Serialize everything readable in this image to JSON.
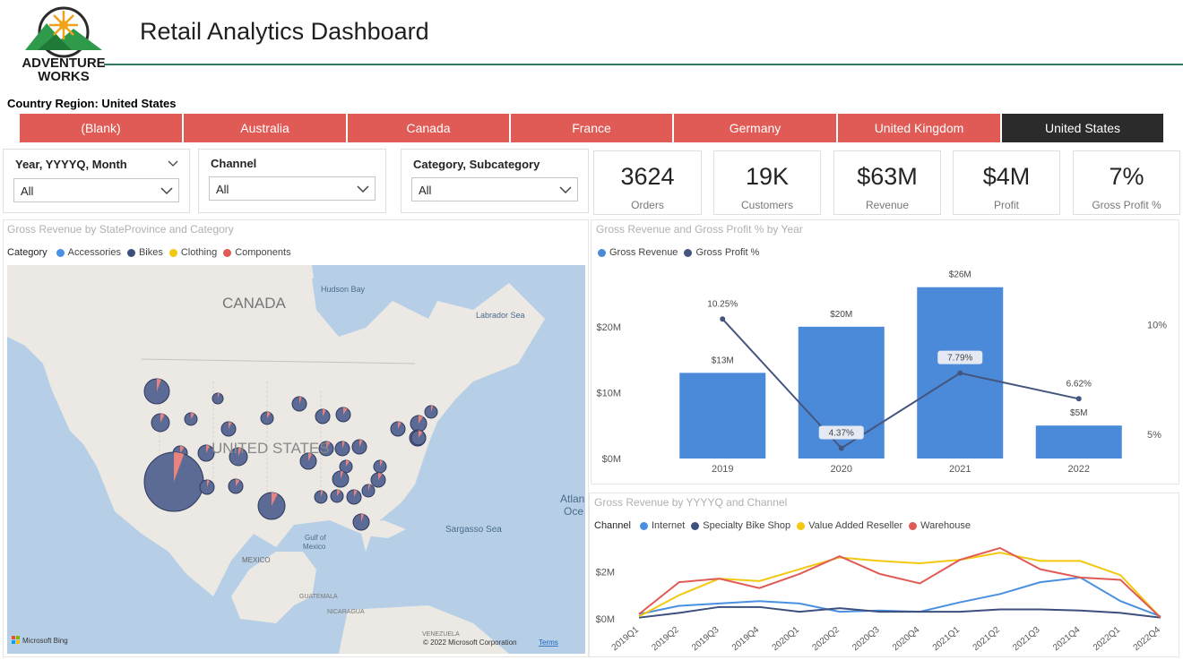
{
  "header": {
    "logo_text_line1": "ADVENTURE",
    "logo_text_line2": "WORKS",
    "title": "Retail Analytics Dashboard",
    "country_label": "Country Region: United States"
  },
  "country_tabs": [
    {
      "label": "(Blank)",
      "selected": false
    },
    {
      "label": "Australia",
      "selected": false
    },
    {
      "label": "Canada",
      "selected": false
    },
    {
      "label": "France",
      "selected": false
    },
    {
      "label": "Germany",
      "selected": false
    },
    {
      "label": "United Kingdom",
      "selected": false
    },
    {
      "label": "United States",
      "selected": true
    }
  ],
  "slicers": [
    {
      "header": "Year, YYYYQ, Month",
      "value": "All"
    },
    {
      "header": "Channel",
      "value": "All"
    },
    {
      "header": "Category, Subcategory",
      "value": "All"
    }
  ],
  "cards": [
    {
      "value": "3624",
      "label": "Orders"
    },
    {
      "value": "19K",
      "label": "Customers"
    },
    {
      "value": "$63M",
      "label": "Revenue"
    },
    {
      "value": "$4M",
      "label": "Profit"
    },
    {
      "value": "7%",
      "label": "Gross Profit %"
    }
  ],
  "map_visual": {
    "title": "Gross Revenue by StateProvince and Category",
    "legend_title": "Category",
    "legend": [
      {
        "name": "Accessories",
        "color": "#4a90e2"
      },
      {
        "name": "Bikes",
        "color": "#3d4f7c"
      },
      {
        "name": "Clothing",
        "color": "#f2c811"
      },
      {
        "name": "Components",
        "color": "#e05b55"
      }
    ],
    "labels": {
      "canada": "CANADA",
      "hudson": "Hudson Bay",
      "labrador": "Labrador Sea",
      "us": "UNITED STATES",
      "atlantic": "Atlan\nOce",
      "sargasso": "Sargasso Sea",
      "gulf": "Gulf of\nMexico",
      "mexico": "MEXICO",
      "guatemala": "GUATEMALA",
      "nicaragua": "NICARAGUA",
      "venezuela": "VENEZUELA",
      "bing": "Microsoft Bing",
      "copyright": "© 2022 Microsoft Corporation",
      "terms": "Terms"
    }
  },
  "chart_data": [
    {
      "type": "bar",
      "title": "Gross Revenue and Gross Profit % by Year",
      "categories": [
        "2019",
        "2020",
        "2021",
        "2022"
      ],
      "series": [
        {
          "name": "Gross Revenue",
          "type": "bar",
          "values": [
            13,
            20,
            26,
            5
          ],
          "unit": "$M",
          "data_labels": [
            "$13M",
            "$20M",
            "$26M",
            "$5M"
          ],
          "color": "#4a8ad9"
        },
        {
          "name": "Gross Profit %",
          "type": "line",
          "values": [
            10.25,
            4.37,
            7.79,
            6.62
          ],
          "data_labels": [
            "10.25%",
            "4.37%",
            "7.79%",
            "6.62%"
          ],
          "color": "#45567e"
        }
      ],
      "y_ticks": [
        "$0M",
        "$10M",
        "$20M"
      ],
      "ylim": [
        0,
        28
      ],
      "y2_ticks": [
        "5%",
        "10%"
      ],
      "y2lim": [
        3.9,
        12.3
      ]
    },
    {
      "type": "line",
      "title": "Gross Revenue by YYYYQ and Channel",
      "legend_title": "Channel",
      "categories": [
        "2019Q1",
        "2019Q2",
        "2019Q3",
        "2019Q4",
        "2020Q1",
        "2020Q2",
        "2020Q3",
        "2020Q4",
        "2021Q1",
        "2021Q2",
        "2021Q3",
        "2021Q4",
        "2022Q1",
        "2022Q4"
      ],
      "y_ticks": [
        "$0M",
        "$2M"
      ],
      "ylim": [
        0,
        3.3
      ],
      "series": [
        {
          "name": "Internet",
          "color": "#4a90e2",
          "values": [
            0.2,
            0.55,
            0.65,
            0.75,
            0.65,
            0.3,
            0.35,
            0.3,
            0.7,
            1.05,
            1.55,
            1.75,
            0.75,
            0.1
          ]
        },
        {
          "name": "Specialty Bike Shop",
          "color": "#3d4f7c",
          "values": [
            0.05,
            0.25,
            0.5,
            0.5,
            0.3,
            0.45,
            0.3,
            0.3,
            0.3,
            0.4,
            0.4,
            0.35,
            0.25,
            0.05
          ]
        },
        {
          "name": "Value Added Reseller",
          "color": "#f2c811",
          "values": [
            0.1,
            1.0,
            1.7,
            1.6,
            2.1,
            2.6,
            2.45,
            2.35,
            2.5,
            2.8,
            2.45,
            2.45,
            1.85,
            0.05
          ]
        },
        {
          "name": "Warehouse",
          "color": "#e05b55",
          "values": [
            0.2,
            1.55,
            1.7,
            1.3,
            1.9,
            2.65,
            1.9,
            1.5,
            2.5,
            3.0,
            2.1,
            1.75,
            1.65,
            0.05
          ]
        }
      ]
    }
  ]
}
